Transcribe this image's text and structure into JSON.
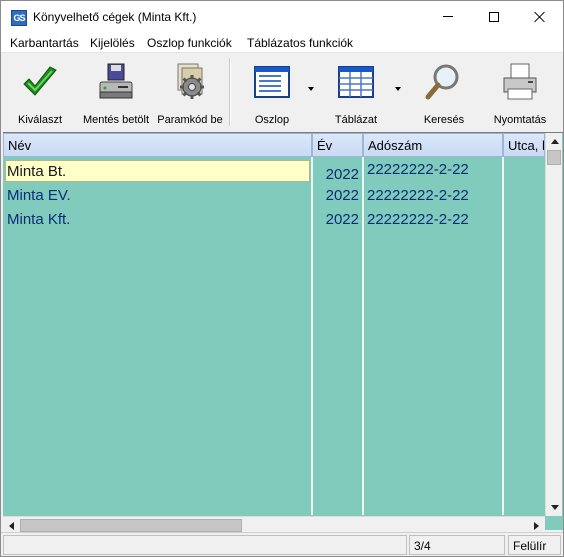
{
  "window": {
    "title": "Könyvelhető cégek (Minta Kft.)",
    "app_icon_text": "GS"
  },
  "menu": {
    "items": [
      "Karbantartás",
      "Kijelölés",
      "Oszlop funkciók",
      "Táblázatos funkciók"
    ]
  },
  "toolbar": {
    "buttons": [
      {
        "label": "Kiválaszt",
        "icon": "checkmark-icon"
      },
      {
        "label": "Mentés betölt",
        "icon": "floppy-computer-icon"
      },
      {
        "label": "Paramkód be",
        "icon": "parameter-gear-icon"
      },
      {
        "label": "Oszlop",
        "icon": "column-view-icon"
      },
      {
        "label": "Táblázat",
        "icon": "table-view-icon"
      },
      {
        "label": "Keresés",
        "icon": "magnifier-icon"
      },
      {
        "label": "Nyomtatás",
        "icon": "printer-icon"
      }
    ]
  },
  "grid": {
    "columns": [
      "Név",
      "Év",
      "Adószám",
      "Utca, h"
    ],
    "rows": [
      {
        "name": "Minta Bt.",
        "year": "2022",
        "tax": "22222222-2-22"
      },
      {
        "name": "Minta EV.",
        "year": "2022",
        "tax": "22222222-2-22"
      },
      {
        "name": "Minta Kft.",
        "year": "2022",
        "tax": "22222222-2-22"
      }
    ],
    "colors": {
      "background": "#80cbbc",
      "selected": "#ffffc8",
      "text": "#0b2d78"
    }
  },
  "status": {
    "position": "3/4",
    "mode": "Felülír"
  }
}
